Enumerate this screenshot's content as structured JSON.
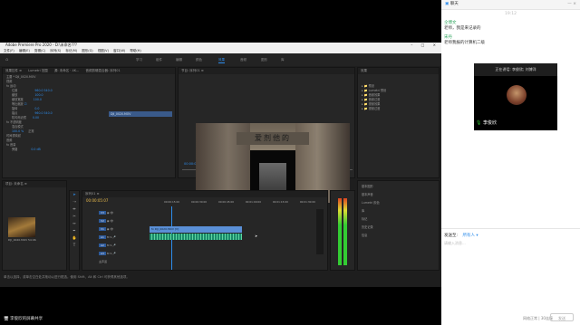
{
  "premiere": {
    "window_title": "Adobe Premiere Pro 2020 - D:\\未命名???",
    "window_controls": "– □ ×",
    "menu": [
      "文件(F)",
      "编辑(E)",
      "剪辑(C)",
      "序列(S)",
      "标记(M)",
      "图形(G)",
      "视图(V)",
      "窗口(W)",
      "帮助(H)"
    ],
    "workspaces": [
      "学习",
      "组件",
      "编辑",
      "颜色",
      "效果",
      "音频",
      "图形",
      "库"
    ],
    "active_workspace": "效果",
    "source_tabs": [
      "效果控件 ≡",
      "Lumetri 范围",
      "源: 未命名 · 4K...",
      "音频剪辑混合器: 序列01"
    ],
    "effect_rows": [
      "主要 * DJI_0020.MOV",
      "视频",
      "fx 运动",
      "位置",
      "缩放",
      "缩放宽度",
      "等比缩放",
      "旋转",
      "锚点",
      "防闪烁滤镜",
      "fx 不透明度",
      "混合模式",
      "时间重映射",
      "音频",
      "fx 音量",
      "旁路"
    ],
    "effect_values": [
      "960.0  540.0",
      "100.0",
      "100.0",
      "0.0",
      "960.0  540.0",
      "0.00",
      "100.0 %",
      "正常",
      "0.0 dB"
    ],
    "clip_name": "DJI_0020.MOV",
    "program_tab": "节目: 序列01 ≡",
    "program_timecode": "00:00:05:06",
    "program_fit": "适合",
    "program_duration": "00:00:54:06",
    "program_full": "完整",
    "sign_text": "爱剂他的",
    "right_panel_title": "效果",
    "right_tree": [
      "预设",
      "Lumetri 预设",
      "音频效果",
      "音频过渡",
      "视频效果",
      "视频过渡"
    ],
    "right_lower": [
      "基本图形",
      "基本声音",
      "Lumetri 颜色",
      "库",
      "标记",
      "历史记录",
      "信息"
    ],
    "project_tab": "项目: 未命名 ≡",
    "project_item": "DJI_0020.MOV",
    "project_item_dur": "54:06",
    "timeline_tab": "序列01 ≡",
    "timeline_timecode": "00:00:05:07",
    "ruler": [
      "00:00:15:00",
      "00:00:30:00",
      "00:00:45:00",
      "00:01:00:00",
      "00:01:15:00",
      "00:01:30:00"
    ],
    "tracks": [
      "V3",
      "V2",
      "V1",
      "A1",
      "A2",
      "A3",
      "主声道"
    ],
    "clip_label": "fx DJI_0020.MOV [V]",
    "status_text": "单击以选择，或单击空白处并拖动以进行框选。使用 Shift、Alt 和 Ctrl 可获得其他选项。",
    "share_label": "李俊欣的屏幕共享"
  },
  "chat": {
    "title": "聊天",
    "time": "19:12",
    "messages": [
      {
        "name": "仝博文",
        "text": "老师，我是来记录的"
      },
      {
        "name": "宋丹",
        "text": "老师我报的计算机二级"
      }
    ],
    "video_caption": "正在讲话: 李俊欣; 刘博洋",
    "speaker_name": "李俊欣",
    "send_to_label": "发送至:",
    "send_to_value": "所有人",
    "input_placeholder": "请输入消息...",
    "status": "网络正常 | 30连接",
    "send_button": "发送"
  }
}
